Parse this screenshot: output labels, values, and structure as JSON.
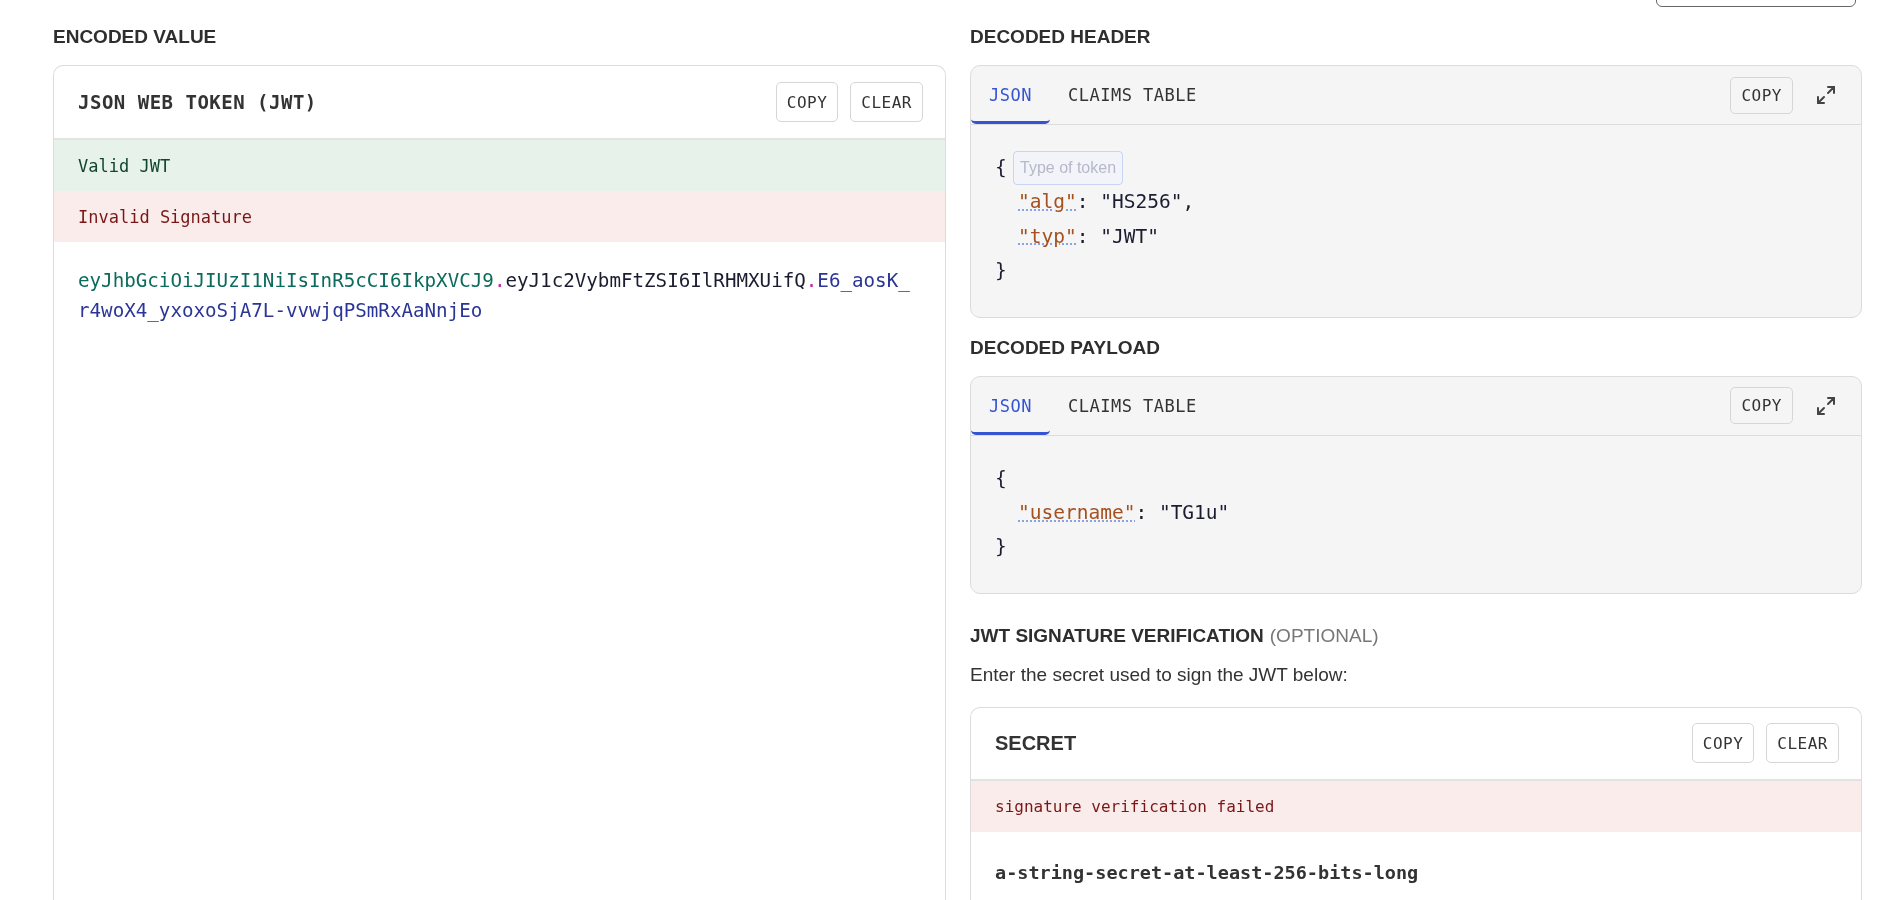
{
  "encoded": {
    "title": "ENCODED VALUE",
    "panel_title": "JSON WEB TOKEN (JWT)",
    "buttons": [
      "COPY",
      "CLEAR"
    ],
    "messages": [
      {
        "text": "Valid JWT",
        "kind": "success"
      },
      {
        "text": "Invalid Signature",
        "kind": "error"
      }
    ],
    "token": [
      {
        "text": "eyJhbGciOiJIUzI1NiIsInR5cCI6IkpXVCJ9",
        "kind": "header"
      },
      {
        "text": ".",
        "kind": "separator"
      },
      {
        "text": "eyJ1c2VybmFtZSI6IlRHMXUifQ",
        "kind": "payload"
      },
      {
        "text": ".",
        "kind": "separator"
      },
      {
        "text": "E6_aosK_r4woX4_yxoxoSjA7L-vvwjqPSmRxAaNnjEo",
        "kind": "signature"
      }
    ]
  },
  "decoded_header": {
    "title": "DECODED HEADER",
    "buttons": [
      "COPY"
    ],
    "tabs": [
      {
        "label": "JSON",
        "selected": true
      },
      {
        "label": "CLAIMS TABLE",
        "selected": false
      }
    ],
    "code": {
      "open": "{",
      "close": "}",
      "entries": [
        {
          "tokens": [
            {
              "text": "\"alg\"",
              "kind": "key"
            },
            {
              "text": ": ",
              "kind": "punct"
            },
            {
              "text": "\"HS256\"",
              "kind": "string"
            },
            {
              "text": ",",
              "kind": "punct"
            }
          ]
        },
        {
          "tokens": [
            {
              "text": "\"typ\"",
              "kind": "key"
            },
            {
              "text": ": ",
              "kind": "punct"
            },
            {
              "text": "\"JWT\"",
              "kind": "string"
            }
          ]
        }
      ]
    },
    "tooltip": "Type of token"
  },
  "decoded_payload": {
    "title": "DECODED PAYLOAD",
    "buttons": [
      "COPY"
    ],
    "tabs": [
      {
        "label": "JSON",
        "selected": true
      },
      {
        "label": "CLAIMS TABLE",
        "selected": false
      }
    ],
    "code": {
      "open": "{",
      "close": "}",
      "entries": [
        {
          "tokens": [
            {
              "text": "\"username\"",
              "kind": "key"
            },
            {
              "text": ": ",
              "kind": "punct"
            },
            {
              "text": "\"TG1u\"",
              "kind": "string"
            }
          ]
        }
      ]
    }
  },
  "verification": {
    "title": "JWT SIGNATURE VERIFICATION",
    "title_note": "(OPTIONAL)",
    "description": "Enter the secret used to sign the JWT below:",
    "panel_title": "SECRET",
    "buttons": [
      "COPY",
      "CLEAR"
    ],
    "messages": [
      {
        "text": "signature verification failed",
        "kind": "error"
      }
    ],
    "secret": "a-string-secret-at-least-256-bits-long"
  }
}
